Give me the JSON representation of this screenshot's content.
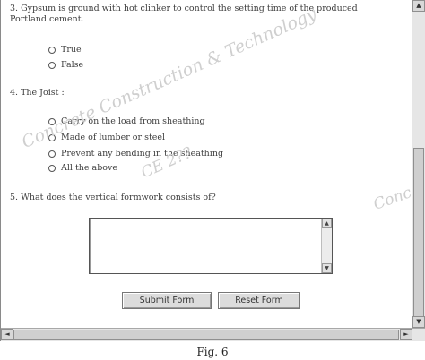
{
  "questions": {
    "q3": {
      "text": "3. Gypsum is ground with hot clinker to control the setting time of the produced Portland cement.",
      "options": [
        "True",
        "False"
      ]
    },
    "q4": {
      "text": "4. The Joist :",
      "options": [
        "Carry on the load from sheathing",
        "Made of lumber or steel",
        "Prevent any bending in the sheathing",
        "All the above"
      ]
    },
    "q5": {
      "text": "5. What does the vertical formwork consists of?",
      "answer_value": ""
    }
  },
  "buttons": {
    "submit": "Submit Form",
    "reset": "Reset Form"
  },
  "scrollbar_glyphs": {
    "up": "▲",
    "down": "▼",
    "left": "◄",
    "right": "►"
  },
  "watermark": {
    "line1": "Concrete Construction & Technology",
    "line2": "CE 2??",
    "side": "Conc"
  },
  "caption": "Fig. 6"
}
